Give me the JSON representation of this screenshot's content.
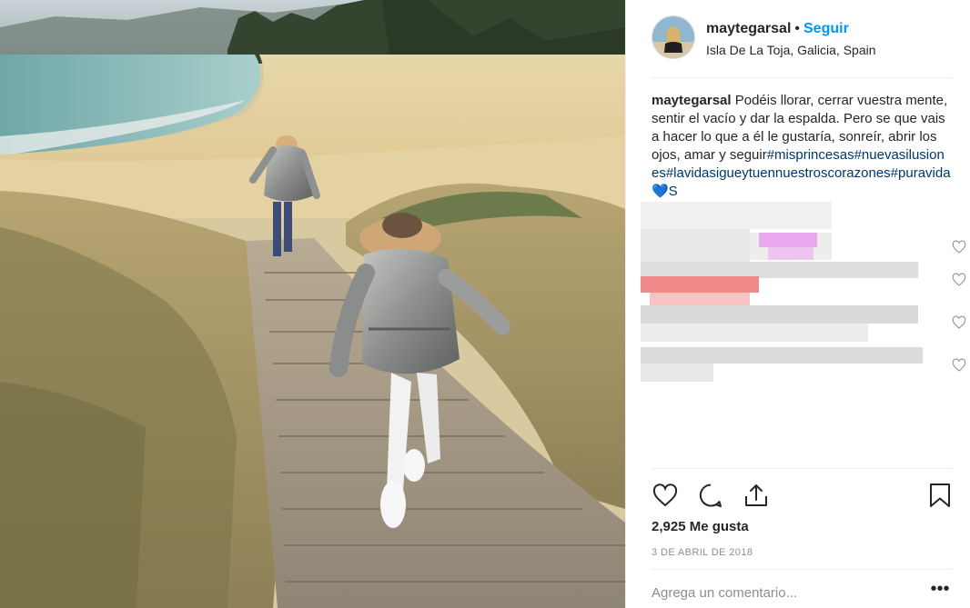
{
  "post": {
    "username": "maytegarsal",
    "separator": "•",
    "follow_label": "Seguir",
    "location": "Isla De La Toja, Galicia, Spain"
  },
  "caption": {
    "username": "maytegarsal",
    "text": "Podéis llorar, cerrar vuestra mente, sentir el vacío y dar la espalda. Pero se que vais a hacer lo que a él le gustaría, sonreír, abrir los ojos, amar y seguir",
    "hashtags": "#misprincesas#nuevasilusiones#lavidasigueytuennuestroscorazones#puravida💙S"
  },
  "actions": {
    "like_icon": "heart-outline-icon",
    "comment_icon": "comment-bubble-icon",
    "share_icon": "share-icon",
    "save_icon": "bookmark-icon"
  },
  "stats": {
    "likes": "2,925 Me gusta",
    "date": "3 DE ABRIL DE 2018"
  },
  "comment_form": {
    "placeholder": "Agrega un comentario...",
    "more_label": "•••"
  },
  "colors": {
    "accent": "#0095f6",
    "hashtag": "#00376b",
    "muted": "#8e8e8e",
    "border": "#efefef"
  }
}
